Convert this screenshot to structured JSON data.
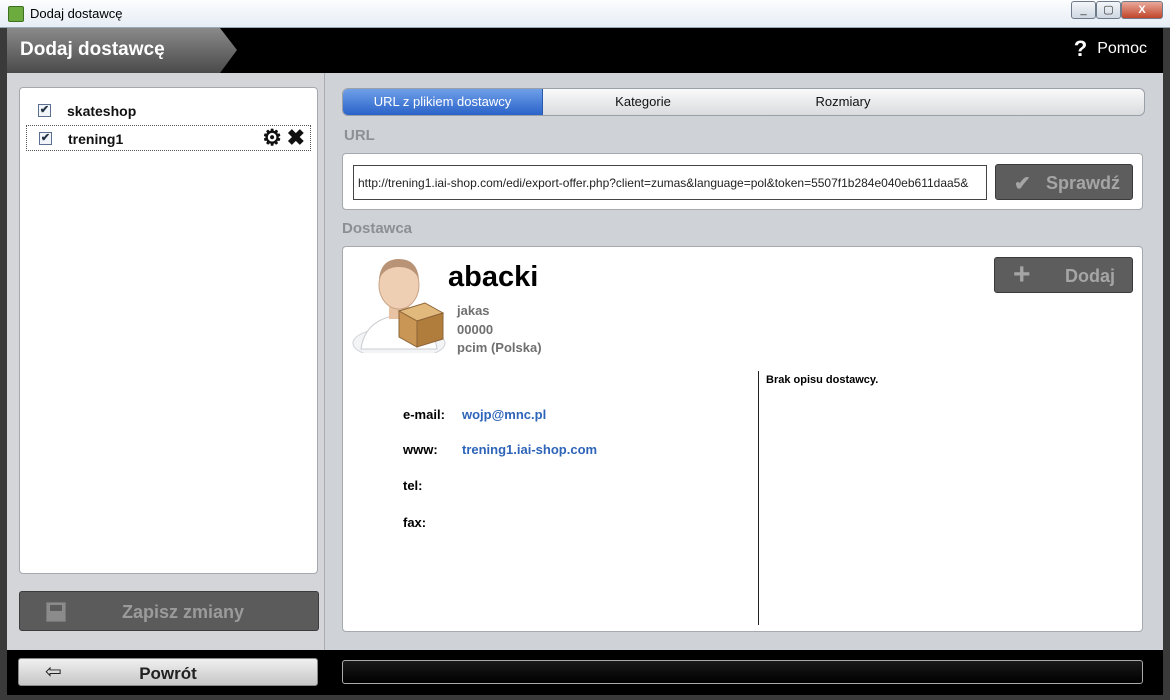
{
  "window": {
    "title": "Dodaj dostawcę",
    "minimize": "_",
    "maximize": "▢",
    "close": "X"
  },
  "header": {
    "title": "Dodaj dostawcę",
    "help_label": "Pomoc"
  },
  "sidebar": {
    "items": [
      {
        "label": "skateshop",
        "checked": true
      },
      {
        "label": "trening1",
        "checked": true
      }
    ],
    "save_label": "Zapisz zmiany"
  },
  "tabs": [
    {
      "label": "URL z plikiem dostawcy",
      "active": true
    },
    {
      "label": "Kategorie",
      "active": false
    },
    {
      "label": "Rozmiary",
      "active": false
    }
  ],
  "url_section": {
    "label": "URL",
    "value": "http://trening1.iai-shop.com/edi/export-offer.php?client=zumas&language=pol&token=5507f1b284e040eb611daa5&",
    "check_label": "Sprawdź"
  },
  "supplier": {
    "section_label": "Dostawca",
    "name": "abacki",
    "address": [
      "jakas",
      "00000",
      "pcim (Polska)"
    ],
    "add_label": "Dodaj",
    "contact": [
      {
        "label": "e-mail:",
        "value": "wojp@mnc.pl"
      },
      {
        "label": "www:",
        "value": "trening1.iai-shop.com"
      },
      {
        "label": "tel:",
        "value": ""
      },
      {
        "label": "fax:",
        "value": ""
      }
    ],
    "description": "Brak opisu dostawcy."
  },
  "footer": {
    "back_label": "Powrót",
    "progress": 0
  },
  "colors": {
    "accent": "#2a63c9",
    "link": "#2e64b8",
    "dark_button": "#5d5d5d"
  }
}
